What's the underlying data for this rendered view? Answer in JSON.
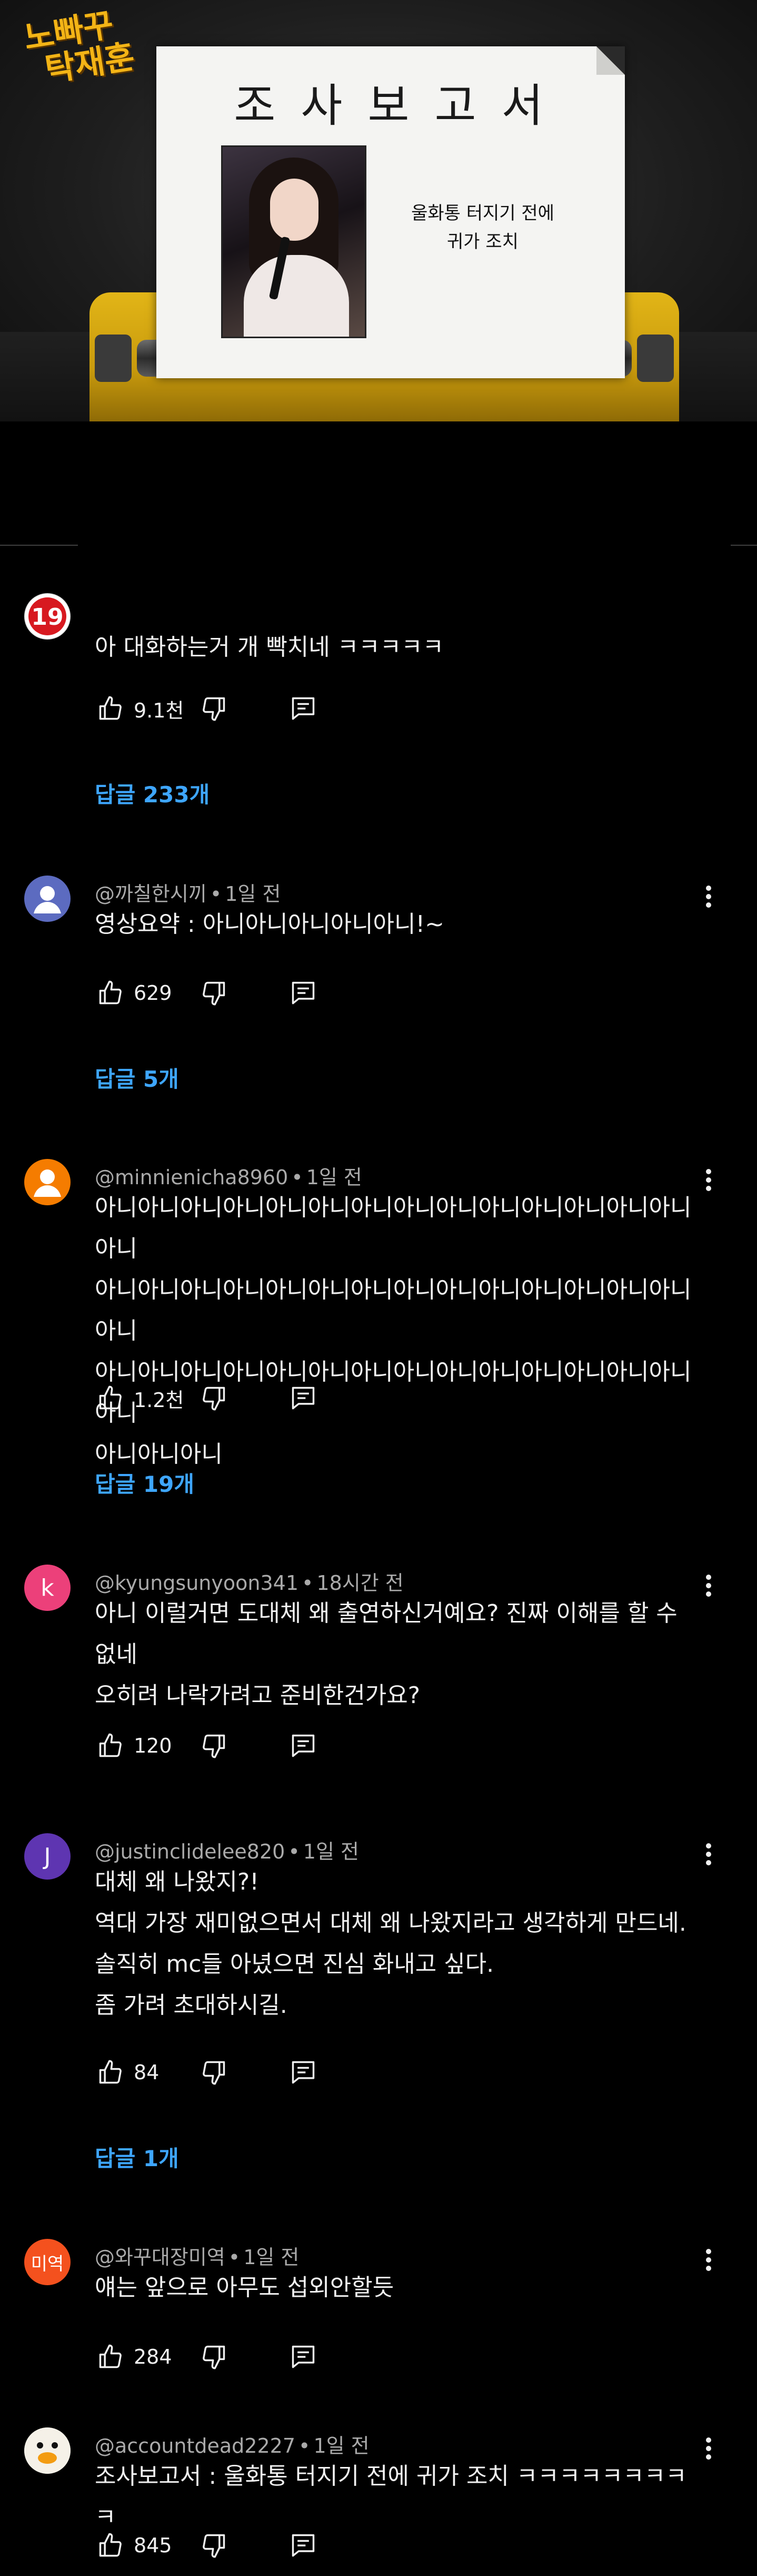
{
  "thumbnail": {
    "show_logo_line1": "노빠꾸",
    "show_logo_line2": "탁재훈",
    "paper_title": "조사보고서",
    "paper_caption_line1": "울화통 터지기 전에",
    "paper_caption_line2": "귀가 조치"
  },
  "colors": {
    "background": "#000000",
    "text": "#f1f1f1",
    "meta": "#aaaaaa",
    "link": "#3ea6ff"
  },
  "comments": [
    {
      "avatar_kind": "age-19-badge",
      "avatar_text": "19",
      "author": "",
      "time": "",
      "text": "아 대화하는거 개 빡치네 ㅋㅋㅋㅋㅋ",
      "likes": "9.1천",
      "replies": "답글 233개"
    },
    {
      "avatar_kind": "default-person",
      "author": "@까칠한시끼",
      "time": "1일 전",
      "text": "영상요약 : 아니아니아니아니아니!~",
      "likes": "629",
      "replies": "답글 5개"
    },
    {
      "avatar_kind": "default-person",
      "author": "@minnienicha8960",
      "time": "1일 전",
      "text": "아니아니아니아니아니아니아니아니아니아니아니아니아니아니아니\n아니아니아니아니아니아니아니아니아니아니아니아니아니아니아니\n아니아니아니아니아니아니아니아니아니아니아니아니아니아니아니\n아니아니아니",
      "likes": "1.2천",
      "replies": "답글 19개"
    },
    {
      "avatar_kind": "letter",
      "avatar_text": "k",
      "author": "@kyungsunyoon341",
      "time": "18시간 전",
      "text": "아니 이럴거면 도대체 왜 출연하신거예요? 진짜 이해를 할 수\n없네\n오히려 나락가려고 준비한건가요?",
      "likes": "120",
      "replies": ""
    },
    {
      "avatar_kind": "letter",
      "avatar_text": "J",
      "author": "@justinclidelee820",
      "time": "1일 전",
      "text": "대체 왜 나왔지?!\n역대 가장 재미없으면서 대체 왜 나왔지라고 생각하게 만드네.\n솔직히 mc들 아녔으면 진심 화내고 싶다.\n좀 가려 초대하시길.",
      "likes": "84",
      "replies": "답글 1개"
    },
    {
      "avatar_kind": "letter",
      "avatar_text": "미역",
      "author": "@와꾸대장미역",
      "time": "1일 전",
      "text": "얘는 앞으로 아무도 섭외안할듯",
      "likes": "284",
      "replies": ""
    },
    {
      "avatar_kind": "duck",
      "author": "@accountdead2227",
      "time": "1일 전",
      "text": "조사보고서 : 울화통 터지기 전에 귀가 조치 ㅋㅋㅋㅋㅋㅋㅋㅋㅋ",
      "likes": "845",
      "replies": ""
    }
  ]
}
